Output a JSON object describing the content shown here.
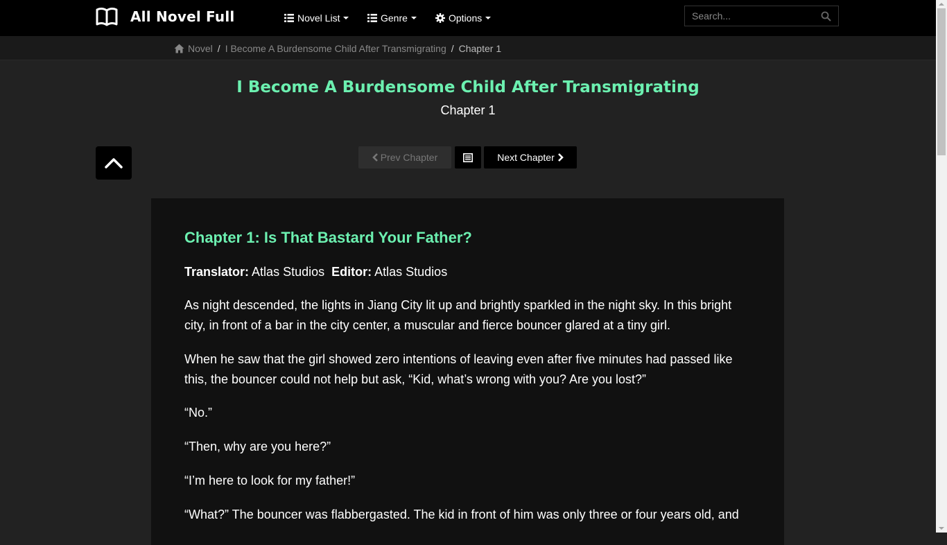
{
  "header": {
    "brand": "All Novel Full",
    "menu": [
      {
        "label": "Novel List",
        "icon": "list-icon"
      },
      {
        "label": "Genre",
        "icon": "list-icon"
      },
      {
        "label": "Options",
        "icon": "gear-icon"
      }
    ],
    "search_placeholder": "Search..."
  },
  "breadcrumb": {
    "home": "Novel",
    "novel": "I Become A Burdensome Child After Transmigrating",
    "current": "Chapter 1"
  },
  "page": {
    "novel_title": "I Become A Burdensome Child After Transmigrating",
    "chapter_subtitle": "Chapter 1"
  },
  "chapter_nav": {
    "prev": "Prev Chapter",
    "next": "Next Chapter"
  },
  "content": {
    "heading": "Chapter 1: Is That Bastard Your Father?",
    "translator_label": "Translator:",
    "translator": "Atlas Studios",
    "editor_label": "Editor:",
    "editor": "Atlas Studios",
    "paragraphs": [
      "As night descended, the lights in Jiang City lit up and brightly sparkled in the night sky. In this bright city, in front of a bar in the city center, a muscular and fierce bouncer glared at a tiny girl.",
      "When he saw that the girl showed zero intentions of leaving even after five minutes had passed like this, the bouncer could not help but ask, “Kid, what’s wrong with you? Are you lost?”",
      "“No.”",
      "“Then, why are you here?”",
      "“I’m here to look for my father!”",
      "“What?” The bouncer was flabbergasted. The kid in front of him was only three or four years old, and"
    ]
  },
  "colors": {
    "accent": "#6cf0b0",
    "nav_bg": "#000000",
    "page_bg": "#222222",
    "content_bg": "#111111"
  }
}
